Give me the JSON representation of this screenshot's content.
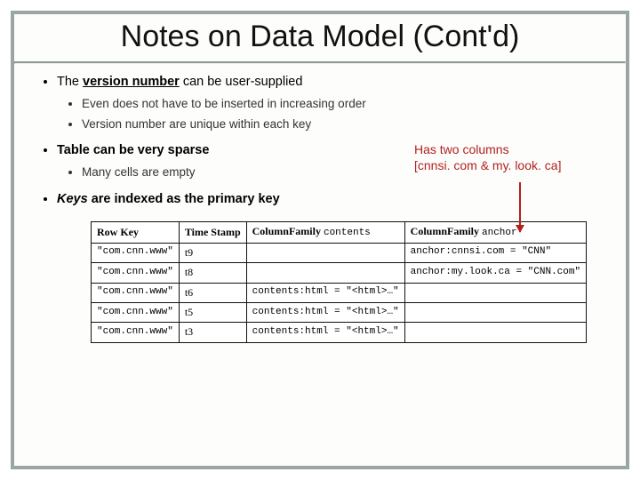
{
  "title": "Notes on Data Model (Cont'd)",
  "bullets": {
    "b1": {
      "pre": "The ",
      "strong": "version number",
      "post": " can be user-supplied",
      "sub1": "Even does not have to be inserted in increasing order",
      "sub2": "Version number are unique within each key"
    },
    "b2": {
      "text": "Table can be very sparse",
      "sub1": "Many cells are empty"
    },
    "b3": {
      "key": "Keys",
      "rest": " are indexed as the primary key"
    }
  },
  "annotation": {
    "line1": "Has two columns",
    "line2": "[cnnsi. com & my. look. ca]"
  },
  "table": {
    "headers": {
      "h1": "Row Key",
      "h2": "Time Stamp",
      "h3_pre": "ColumnFamily ",
      "h3_mono": "contents",
      "h4_pre": "ColumnFamily ",
      "h4_mono": "anchor"
    },
    "rows": [
      {
        "key": "\"com.cnn.www\"",
        "ts": "t9",
        "contents": "",
        "anchor": "anchor:cnnsi.com = \"CNN\""
      },
      {
        "key": "\"com.cnn.www\"",
        "ts": "t8",
        "contents": "",
        "anchor": "anchor:my.look.ca = \"CNN.com\""
      },
      {
        "key": "\"com.cnn.www\"",
        "ts": "t6",
        "contents": "contents:html = \"<html>…\"",
        "anchor": ""
      },
      {
        "key": "\"com.cnn.www\"",
        "ts": "t5",
        "contents": "contents:html = \"<html>…\"",
        "anchor": ""
      },
      {
        "key": "\"com.cnn.www\"",
        "ts": "t3",
        "contents": "contents:html = \"<html>…\"",
        "anchor": ""
      }
    ]
  }
}
